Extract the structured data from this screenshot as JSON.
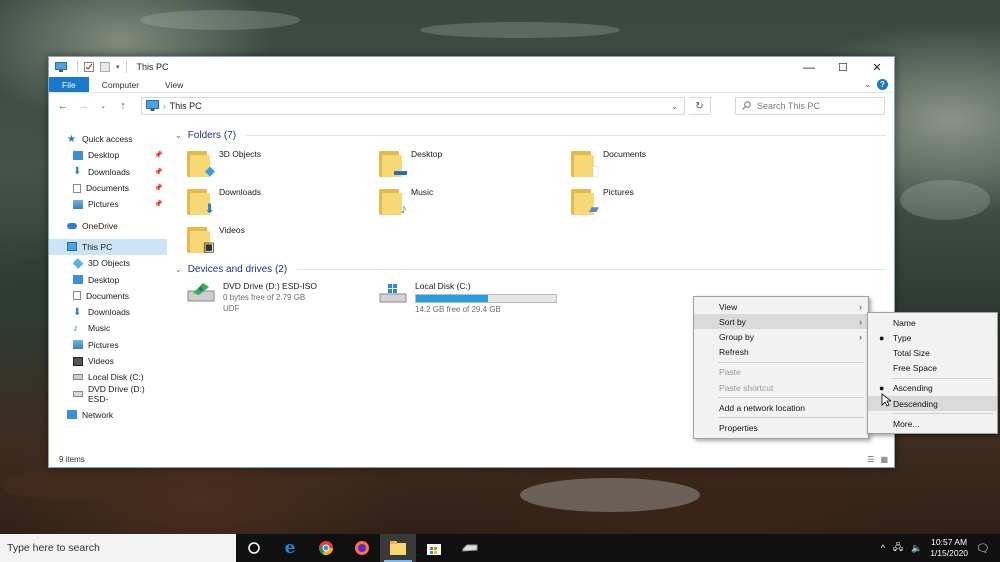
{
  "window": {
    "title": "This PC",
    "controls": {
      "minimize": "—",
      "maximize": "☐",
      "close": "✕"
    }
  },
  "ribbon": {
    "tabs": [
      "File",
      "Computer",
      "View"
    ]
  },
  "address": {
    "path": "This PC",
    "search_placeholder": "Search This PC"
  },
  "nav": {
    "quick_access": "Quick access",
    "quick_items": [
      "Desktop",
      "Downloads",
      "Documents",
      "Pictures"
    ],
    "onedrive": "OneDrive",
    "this_pc": "This PC",
    "pc_items": [
      "3D Objects",
      "Desktop",
      "Documents",
      "Downloads",
      "Music",
      "Pictures",
      "Videos",
      "Local Disk (C:)",
      "DVD Drive (D:) ESD-"
    ],
    "network": "Network"
  },
  "content": {
    "folders_header": "Folders (7)",
    "folders": [
      "3D Objects",
      "Desktop",
      "Documents",
      "Downloads",
      "Music",
      "Pictures",
      "Videos"
    ],
    "devices_header": "Devices and drives (2)",
    "drives": [
      {
        "name": "DVD Drive (D:) ESD-ISO",
        "line2": "0 bytes free of 2.79 GB",
        "line3": "UDF"
      },
      {
        "name": "Local Disk (C:)",
        "line2": "14.2 GB free of 29.4 GB",
        "used_fraction": 0.517
      }
    ]
  },
  "status": {
    "items": "9 items"
  },
  "context_menu": {
    "items": [
      {
        "label": "View",
        "submenu": true
      },
      {
        "label": "Sort by",
        "submenu": true
      },
      {
        "label": "Group by",
        "submenu": true
      },
      {
        "label": "Refresh"
      },
      {
        "label": "Paste",
        "disabled": true
      },
      {
        "label": "Paste shortcut",
        "disabled": true
      },
      {
        "label": "Add a network location"
      },
      {
        "label": "Properties"
      }
    ]
  },
  "sort_submenu": {
    "items": [
      "Name",
      "Type",
      "Total Size",
      "Free Space",
      "Ascending",
      "Descending",
      "More..."
    ],
    "selected_field": "Type",
    "selected_order": "Ascending"
  },
  "taskbar": {
    "search_placeholder": "Type here to search",
    "time": "10:57 AM",
    "date": "1/15/2020"
  },
  "colors": {
    "accent": "#1979ca",
    "selection": "#cce4f7",
    "drive_bar": "#26a0da"
  }
}
